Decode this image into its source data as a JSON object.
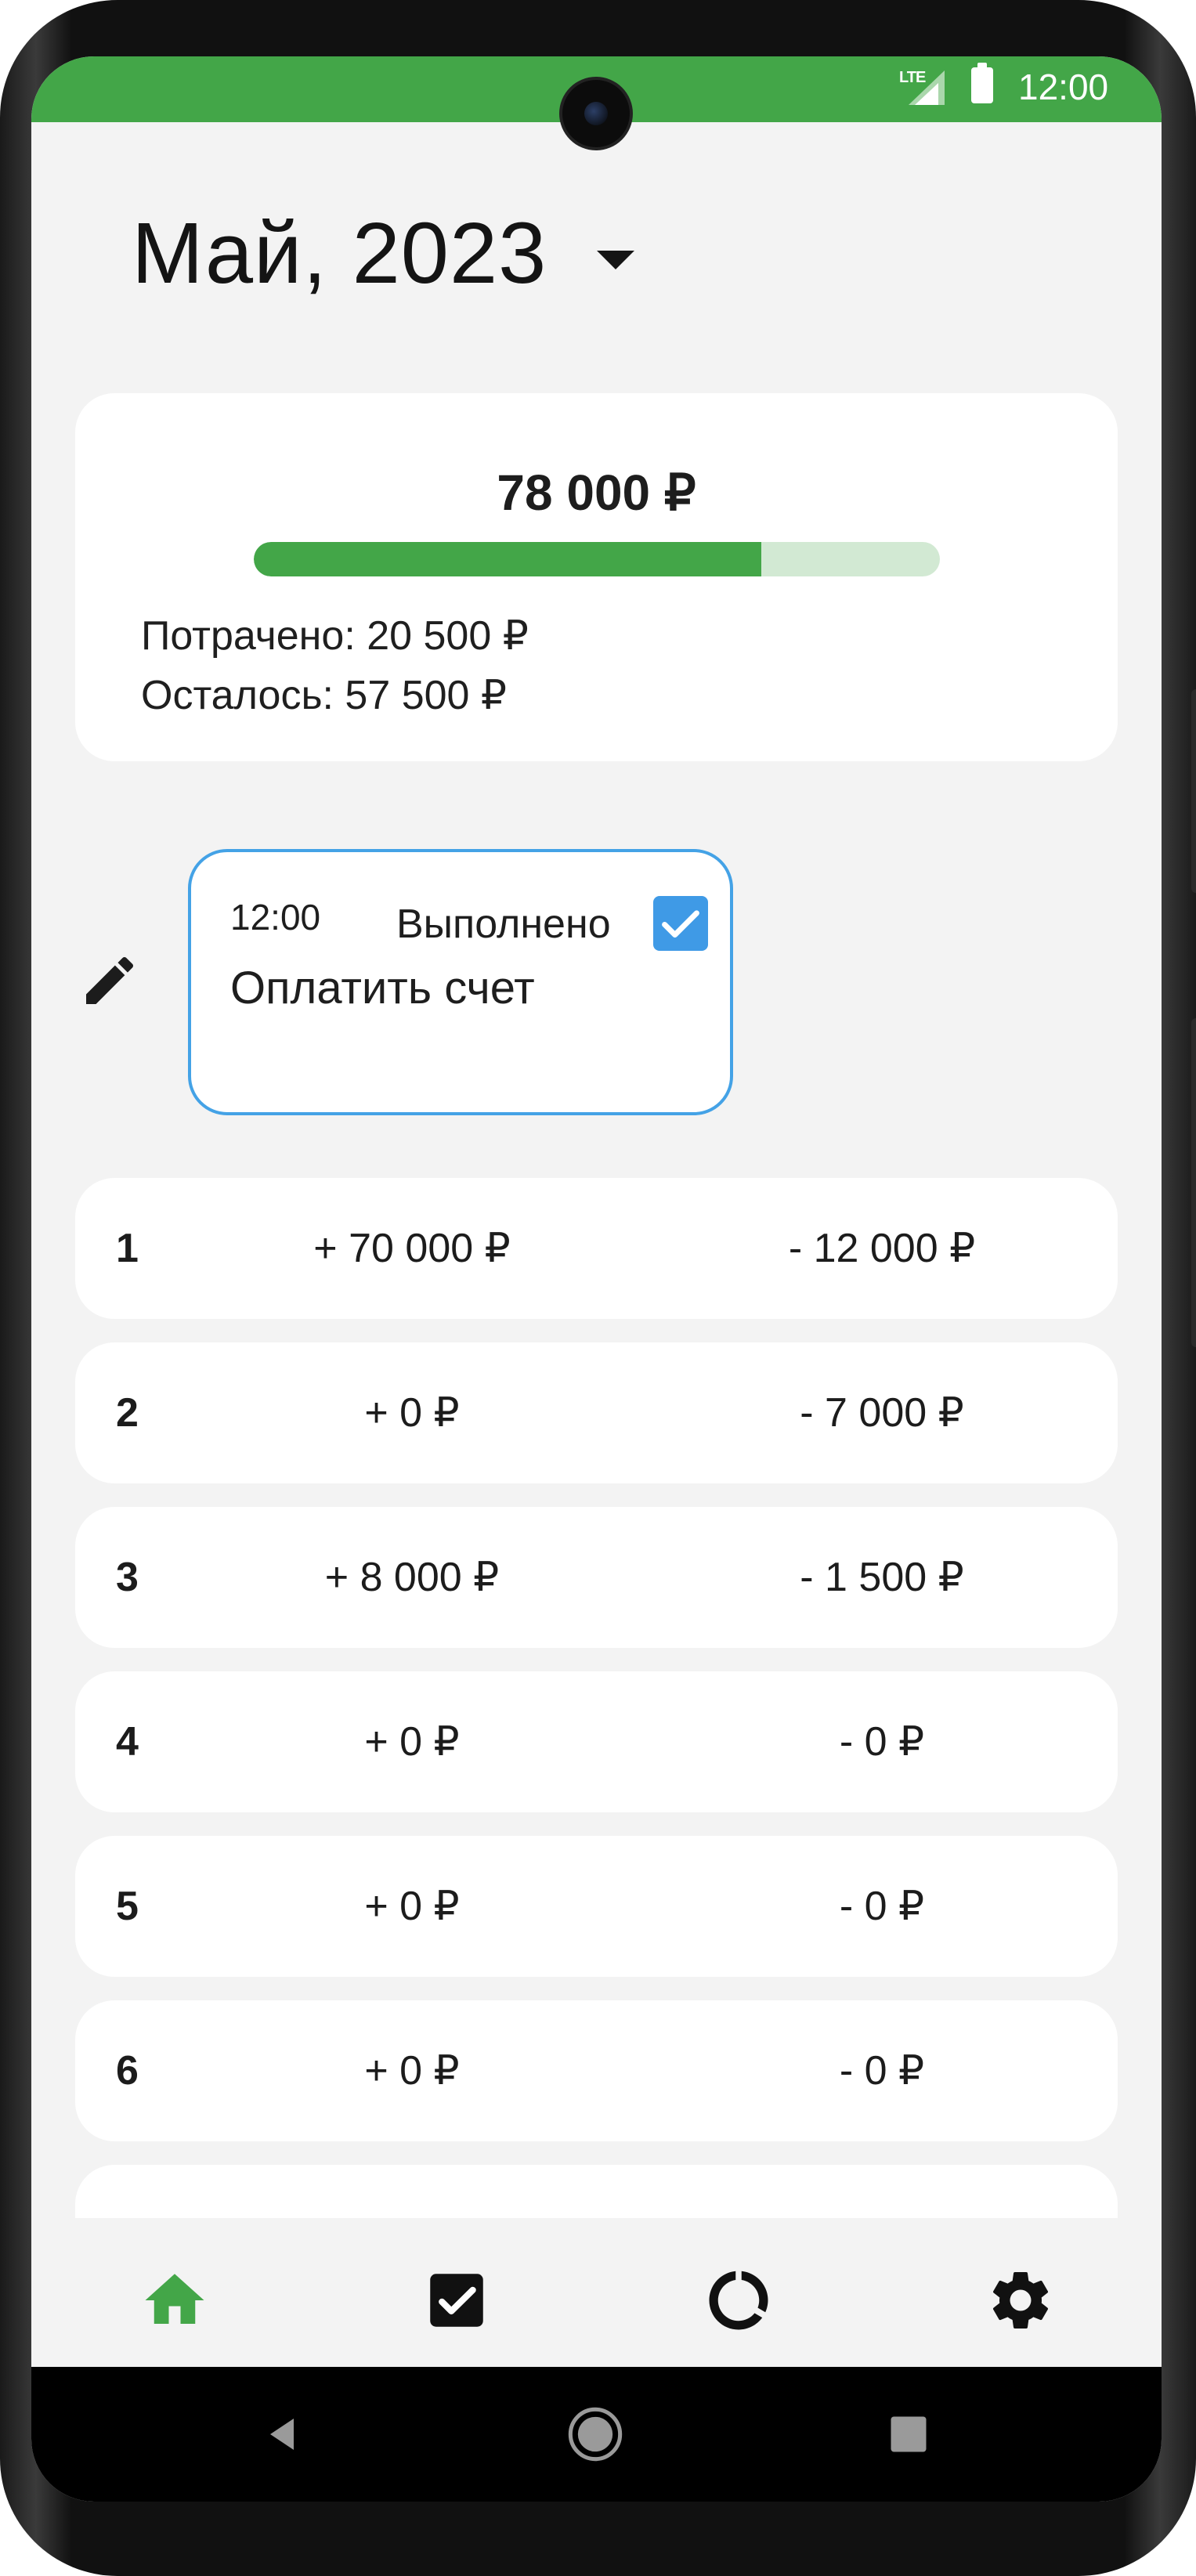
{
  "status_bar": {
    "network": "LTE",
    "time": "12:00"
  },
  "header": {
    "month": "Май, 2023"
  },
  "budget": {
    "total": "78 000 ₽",
    "spent": "Потрачено: 20 500 ₽",
    "remaining": "Осталось: 57 500 ₽",
    "spent_fraction": 0.74,
    "colors": {
      "fill": "#43a648",
      "track": "#d2e9d3"
    }
  },
  "task": {
    "time": "12:00",
    "status": "Выполнено",
    "title": "Оплатить счет",
    "done": true
  },
  "days": [
    {
      "num": "1",
      "income": "+ 70 000 ₽",
      "expense": "- 12 000 ₽"
    },
    {
      "num": "2",
      "income": "+ 0 ₽",
      "expense": "- 7 000 ₽"
    },
    {
      "num": "3",
      "income": "+ 8 000 ₽",
      "expense": "- 1 500 ₽"
    },
    {
      "num": "4",
      "income": "+ 0 ₽",
      "expense": "- 0 ₽"
    },
    {
      "num": "5",
      "income": "+ 0 ₽",
      "expense": "- 0 ₽"
    },
    {
      "num": "6",
      "income": "+ 0 ₽",
      "expense": "- 0 ₽"
    }
  ],
  "nav": {
    "items": [
      {
        "icon": "home-icon",
        "active": true
      },
      {
        "icon": "checkbox-icon",
        "active": false
      },
      {
        "icon": "donut-chart-icon",
        "active": false
      },
      {
        "icon": "gear-icon",
        "active": false
      }
    ],
    "active_color": "#43a648"
  },
  "system_nav": {
    "icons": [
      "back-icon",
      "home-circle-icon",
      "recents-icon"
    ]
  }
}
